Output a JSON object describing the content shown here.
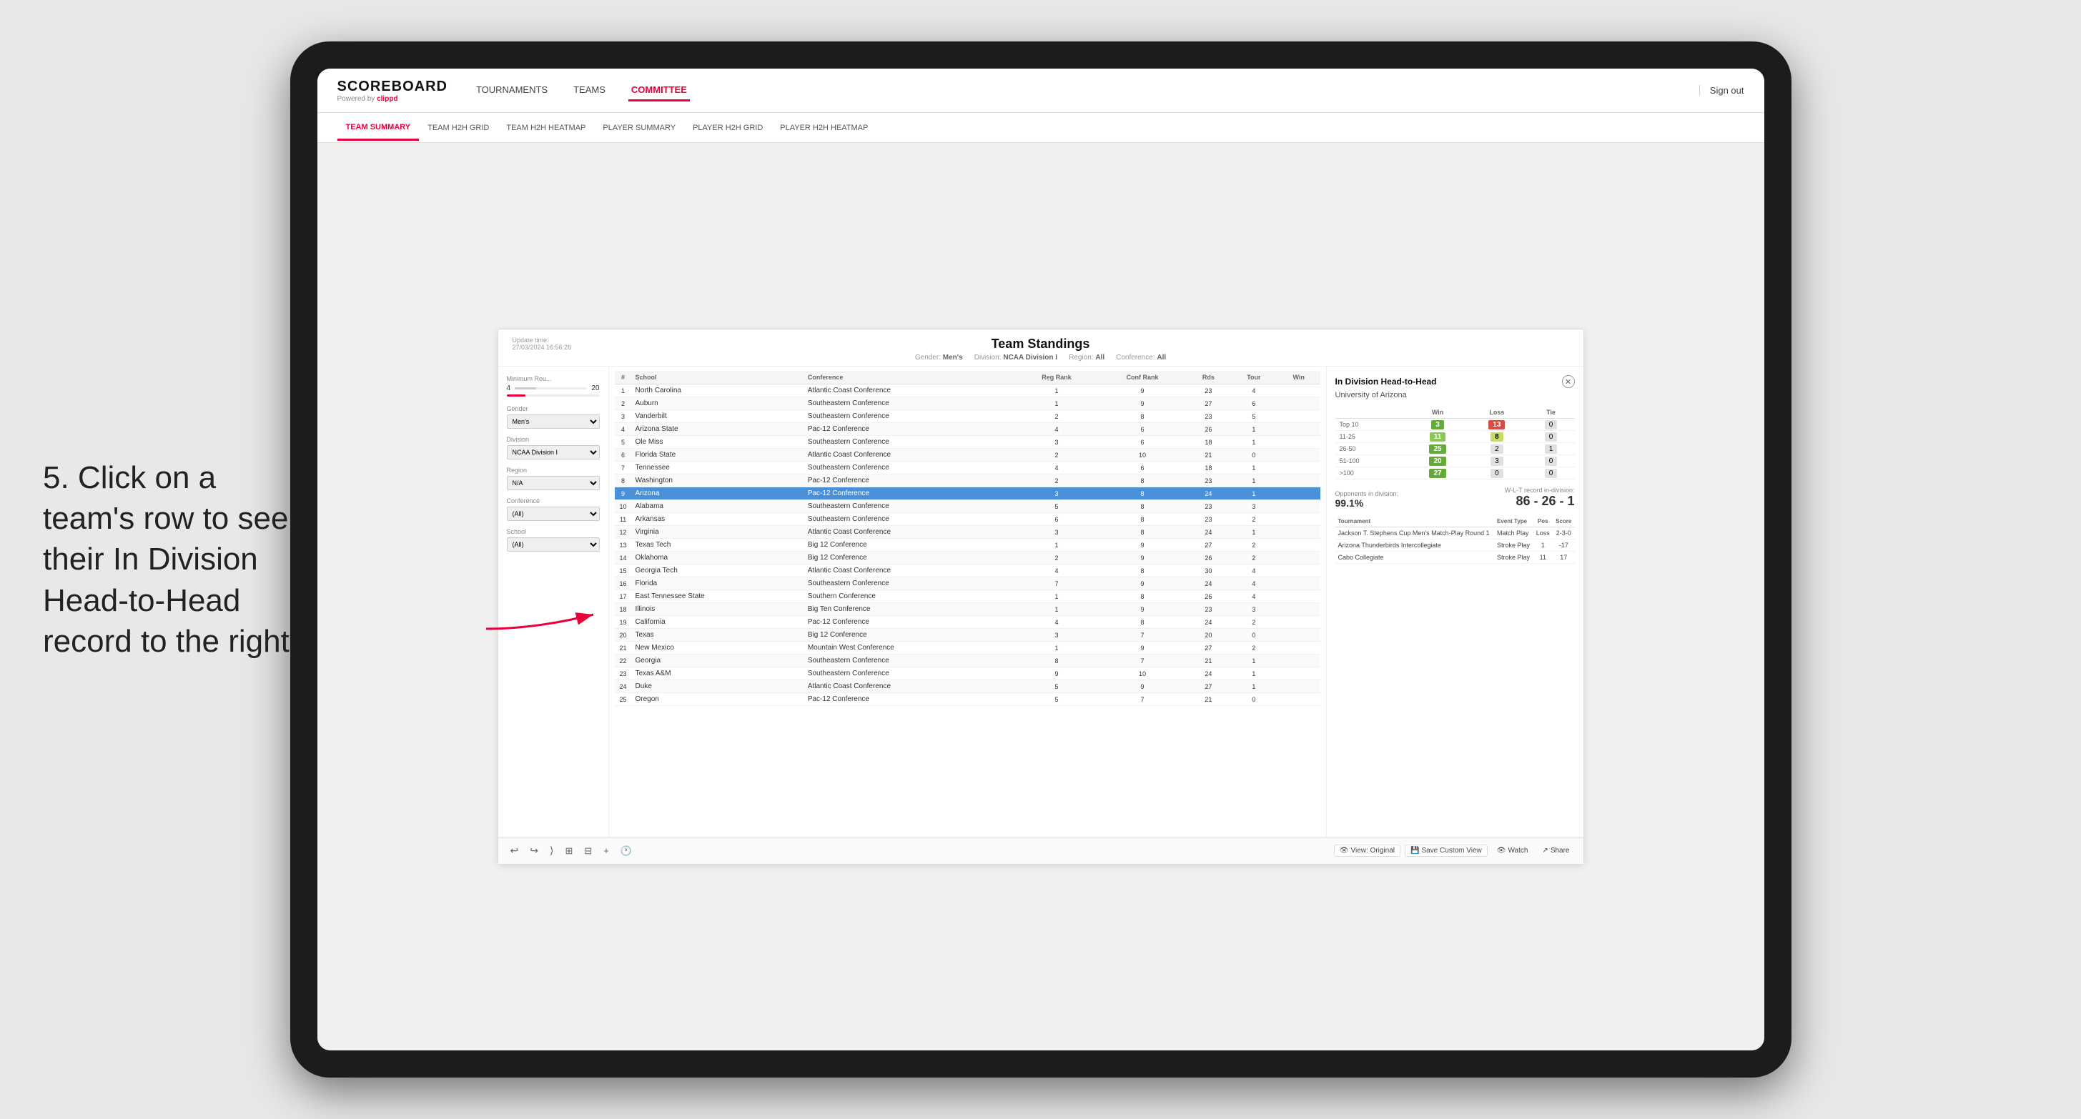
{
  "app": {
    "logo": "SCOREBOARD",
    "logo_sub": "Powered by",
    "logo_brand": "clippd"
  },
  "top_nav": {
    "items": [
      {
        "label": "TOURNAMENTS",
        "active": false
      },
      {
        "label": "TEAMS",
        "active": false
      },
      {
        "label": "COMMITTEE",
        "active": true
      }
    ],
    "sign_out": "Sign out"
  },
  "sub_nav": {
    "items": [
      {
        "label": "TEAM SUMMARY",
        "active": true
      },
      {
        "label": "TEAM H2H GRID",
        "active": false
      },
      {
        "label": "TEAM H2H HEATMAP",
        "active": false
      },
      {
        "label": "PLAYER SUMMARY",
        "active": false
      },
      {
        "label": "PLAYER H2H GRID",
        "active": false
      },
      {
        "label": "PLAYER H2H HEATMAP",
        "active": false
      }
    ]
  },
  "annotation": {
    "text": "5. Click on a team's row to see their In Division Head-to-Head record to the right"
  },
  "dashboard": {
    "update_time_label": "Update time:",
    "update_time": "27/03/2024 16:56:26",
    "title": "Team Standings",
    "gender_label": "Gender:",
    "gender": "Men's",
    "division_label": "Division:",
    "division": "NCAA Division I",
    "region_label": "Region:",
    "region": "All",
    "conference_label": "Conference:",
    "conference": "All"
  },
  "filters": {
    "min_rounds_label": "Minimum Rou...",
    "min_rounds_value": "4",
    "min_rounds_max": "20",
    "gender_label": "Gender",
    "gender_value": "Men's",
    "division_label": "Division",
    "division_value": "NCAA Division I",
    "region_label": "Region",
    "region_value": "N/A",
    "conference_label": "Conference",
    "conference_value": "(All)",
    "school_label": "School",
    "school_value": "(All)"
  },
  "table": {
    "headers": [
      "#",
      "School",
      "Conference",
      "Reg Rank",
      "Conf Rank",
      "Rds",
      "Tour",
      "Win"
    ],
    "rows": [
      {
        "num": 1,
        "school": "North Carolina",
        "conference": "Atlantic Coast Conference",
        "reg_rank": 1,
        "conf_rank": 9,
        "rds": 23,
        "tour": 4,
        "win": ""
      },
      {
        "num": 2,
        "school": "Auburn",
        "conference": "Southeastern Conference",
        "reg_rank": 1,
        "conf_rank": 9,
        "rds": 27,
        "tour": 6,
        "win": ""
      },
      {
        "num": 3,
        "school": "Vanderbilt",
        "conference": "Southeastern Conference",
        "reg_rank": 2,
        "conf_rank": 8,
        "rds": 23,
        "tour": 5,
        "win": ""
      },
      {
        "num": 4,
        "school": "Arizona State",
        "conference": "Pac-12 Conference",
        "reg_rank": 4,
        "conf_rank": 6,
        "rds": 26,
        "tour": 1,
        "win": ""
      },
      {
        "num": 5,
        "school": "Ole Miss",
        "conference": "Southeastern Conference",
        "reg_rank": 3,
        "conf_rank": 6,
        "rds": 18,
        "tour": 1,
        "win": ""
      },
      {
        "num": 6,
        "school": "Florida State",
        "conference": "Atlantic Coast Conference",
        "reg_rank": 2,
        "conf_rank": 10,
        "rds": 21,
        "tour": 0,
        "win": ""
      },
      {
        "num": 7,
        "school": "Tennessee",
        "conference": "Southeastern Conference",
        "reg_rank": 4,
        "conf_rank": 6,
        "rds": 18,
        "tour": 1,
        "win": ""
      },
      {
        "num": 8,
        "school": "Washington",
        "conference": "Pac-12 Conference",
        "reg_rank": 2,
        "conf_rank": 8,
        "rds": 23,
        "tour": 1,
        "win": ""
      },
      {
        "num": 9,
        "school": "Arizona",
        "conference": "Pac-12 Conference",
        "reg_rank": 3,
        "conf_rank": 8,
        "rds": 24,
        "tour": 1,
        "win": "",
        "highlighted": true
      },
      {
        "num": 10,
        "school": "Alabama",
        "conference": "Southeastern Conference",
        "reg_rank": 5,
        "conf_rank": 8,
        "rds": 23,
        "tour": 3,
        "win": ""
      },
      {
        "num": 11,
        "school": "Arkansas",
        "conference": "Southeastern Conference",
        "reg_rank": 6,
        "conf_rank": 8,
        "rds": 23,
        "tour": 2,
        "win": ""
      },
      {
        "num": 12,
        "school": "Virginia",
        "conference": "Atlantic Coast Conference",
        "reg_rank": 3,
        "conf_rank": 8,
        "rds": 24,
        "tour": 1,
        "win": ""
      },
      {
        "num": 13,
        "school": "Texas Tech",
        "conference": "Big 12 Conference",
        "reg_rank": 1,
        "conf_rank": 9,
        "rds": 27,
        "tour": 2,
        "win": ""
      },
      {
        "num": 14,
        "school": "Oklahoma",
        "conference": "Big 12 Conference",
        "reg_rank": 2,
        "conf_rank": 9,
        "rds": 26,
        "tour": 2,
        "win": ""
      },
      {
        "num": 15,
        "school": "Georgia Tech",
        "conference": "Atlantic Coast Conference",
        "reg_rank": 4,
        "conf_rank": 8,
        "rds": 30,
        "tour": 4,
        "win": ""
      },
      {
        "num": 16,
        "school": "Florida",
        "conference": "Southeastern Conference",
        "reg_rank": 7,
        "conf_rank": 9,
        "rds": 24,
        "tour": 4,
        "win": ""
      },
      {
        "num": 17,
        "school": "East Tennessee State",
        "conference": "Southern Conference",
        "reg_rank": 1,
        "conf_rank": 8,
        "rds": 26,
        "tour": 4,
        "win": ""
      },
      {
        "num": 18,
        "school": "Illinois",
        "conference": "Big Ten Conference",
        "reg_rank": 1,
        "conf_rank": 9,
        "rds": 23,
        "tour": 3,
        "win": ""
      },
      {
        "num": 19,
        "school": "California",
        "conference": "Pac-12 Conference",
        "reg_rank": 4,
        "conf_rank": 8,
        "rds": 24,
        "tour": 2,
        "win": ""
      },
      {
        "num": 20,
        "school": "Texas",
        "conference": "Big 12 Conference",
        "reg_rank": 3,
        "conf_rank": 7,
        "rds": 20,
        "tour": 0,
        "win": ""
      },
      {
        "num": 21,
        "school": "New Mexico",
        "conference": "Mountain West Conference",
        "reg_rank": 1,
        "conf_rank": 9,
        "rds": 27,
        "tour": 2,
        "win": ""
      },
      {
        "num": 22,
        "school": "Georgia",
        "conference": "Southeastern Conference",
        "reg_rank": 8,
        "conf_rank": 7,
        "rds": 21,
        "tour": 1,
        "win": ""
      },
      {
        "num": 23,
        "school": "Texas A&M",
        "conference": "Southeastern Conference",
        "reg_rank": 9,
        "conf_rank": 10,
        "rds": 24,
        "tour": 1,
        "win": ""
      },
      {
        "num": 24,
        "school": "Duke",
        "conference": "Atlantic Coast Conference",
        "reg_rank": 5,
        "conf_rank": 9,
        "rds": 27,
        "tour": 1,
        "win": ""
      },
      {
        "num": 25,
        "school": "Oregon",
        "conference": "Pac-12 Conference",
        "reg_rank": 5,
        "conf_rank": 7,
        "rds": 21,
        "tour": 0,
        "win": ""
      }
    ]
  },
  "h2h_panel": {
    "title": "In Division Head-to-Head",
    "team_name": "University of Arizona",
    "table_headers": [
      "",
      "Win",
      "Loss",
      "Tie"
    ],
    "rows": [
      {
        "range": "Top 10",
        "win": 3,
        "loss": 13,
        "tie": 0,
        "win_color": "green",
        "loss_color": "red"
      },
      {
        "range": "11-25",
        "win": 11,
        "loss": 8,
        "tie": 0,
        "win_color": "light-green",
        "loss_color": "yellow-green"
      },
      {
        "range": "26-50",
        "win": 25,
        "loss": 2,
        "tie": 1,
        "win_color": "green",
        "loss_color": "gray"
      },
      {
        "range": "51-100",
        "win": 20,
        "loss": 3,
        "tie": 0,
        "win_color": "green",
        "loss_color": "gray"
      },
      {
        "range": ">100",
        "win": 27,
        "loss": 0,
        "tie": 0,
        "win_color": "green",
        "loss_color": "gray"
      }
    ],
    "opponents_label": "Opponents in division:",
    "opponents_pct": "99.1%",
    "wl_label": "W-L-T record in-division:",
    "wl_record": "86 - 26 - 1",
    "tournaments_header": "Tournament",
    "event_type_header": "Event Type",
    "pos_header": "Pos",
    "score_header": "Score",
    "tournament_rows": [
      {
        "name": "Jackson T. Stephens Cup Men's Match-Play Round 1",
        "type": "Match Play",
        "pos": "Loss",
        "score": "2-3-0"
      },
      {
        "name": "Arizona Thunderbirds Intercollegiate",
        "type": "Stroke Play",
        "pos": "1",
        "score": "-17"
      },
      {
        "name": "Cabo Collegiate",
        "type": "Stroke Play",
        "pos": "11",
        "score": "17"
      }
    ]
  },
  "toolbar": {
    "undo": "↩",
    "view_original": "View: Original",
    "save_custom": "Save Custom View",
    "watch": "Watch",
    "share": "Share"
  }
}
